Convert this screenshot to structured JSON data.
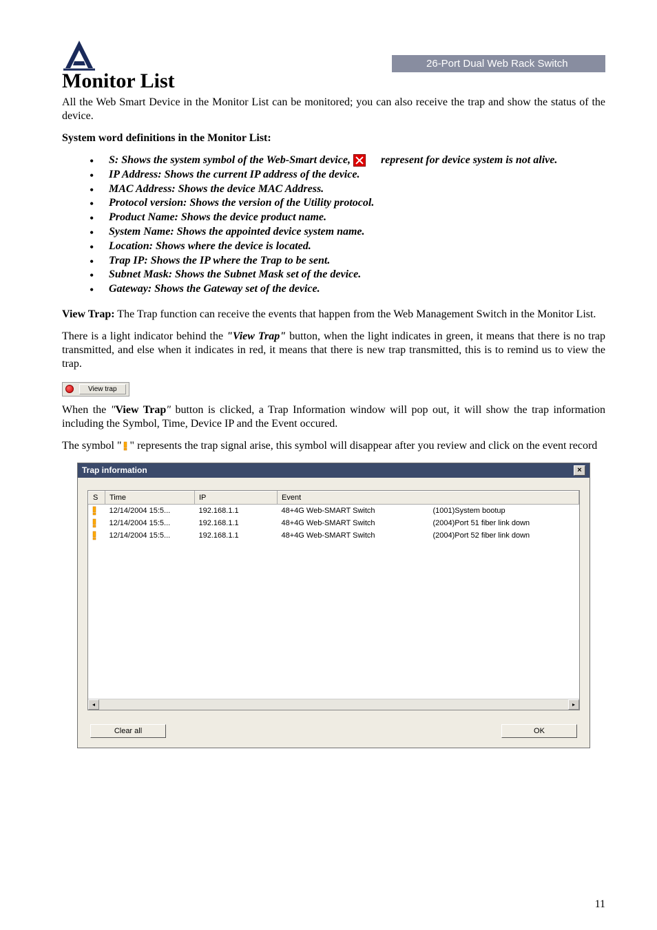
{
  "header": {
    "banner": "26-Port Dual Web Rack Switch"
  },
  "title": "Monitor List",
  "intro": "All the Web Smart Device in the Monitor List can be monitored; you can also receive the trap and show the status of the device.",
  "defs_heading": "System word definitions in the Monitor List:",
  "bullets": {
    "s_pre": "S: Shows the system symbol of the Web-Smart device,",
    "s_post": "represent for device system is not alive.",
    "ip": "IP Address: Shows the current IP address of the device.",
    "mac": "MAC Address: Shows the device MAC Address.",
    "proto": "Protocol version: Shows the version of the Utility protocol.",
    "product": "Product Name: Shows the device product name.",
    "sysname": "System Name: Shows the appointed device system name.",
    "location": "Location: Shows where the device is located.",
    "trapip": "Trap IP: Shows the IP where the Trap to be sent.",
    "subnet": "Subnet Mask: Shows the Subnet Mask set of the device.",
    "gateway": "Gateway: Shows the Gateway set of the device."
  },
  "viewtrap_para": {
    "lead": "View Trap:",
    "rest": " The Trap function can receive the events that happen from the Web Management Switch in the Monitor List."
  },
  "light_para_pre": "There is a light indicator behind the ",
  "light_para_quoted": "\"View Trap\"",
  "light_para_post": " button, when the light indicates in green, it means that there is no trap transmitted, and else when it indicates in red, it means that there is new trap transmitted, this is to remind us to view the trap.",
  "viewtrap_button": "View trap",
  "when_para_pre": "When the ",
  "when_para_bold": "\"View Trap\"",
  "when_para_post": " button is clicked, a Trap Information window will pop out, it will show the trap information including the Symbol, Time, Device IP and the Event occured.",
  "symbol_para_pre": "The symbol \"",
  "symbol_para_post": "\" represents the trap signal arise, this symbol will disappear after you review and click on the event record",
  "window": {
    "title": "Trap information",
    "close": "×",
    "cols": {
      "s": "S",
      "time": "Time",
      "ip": "IP",
      "event": "Event"
    },
    "rows": [
      {
        "time": "12/14/2004 15:5...",
        "ip": "192.168.1.1",
        "event1": "48+4G Web-SMART Switch",
        "event2": "(1001)System bootup"
      },
      {
        "time": "12/14/2004 15:5...",
        "ip": "192.168.1.1",
        "event1": "48+4G Web-SMART Switch",
        "event2": "(2004)Port 51 fiber link down"
      },
      {
        "time": "12/14/2004 15:5...",
        "ip": "192.168.1.1",
        "event1": "48+4G Web-SMART Switch",
        "event2": "(2004)Port 52 fiber link down"
      }
    ],
    "clear": "Clear all",
    "ok": "OK"
  },
  "page_number": "11"
}
